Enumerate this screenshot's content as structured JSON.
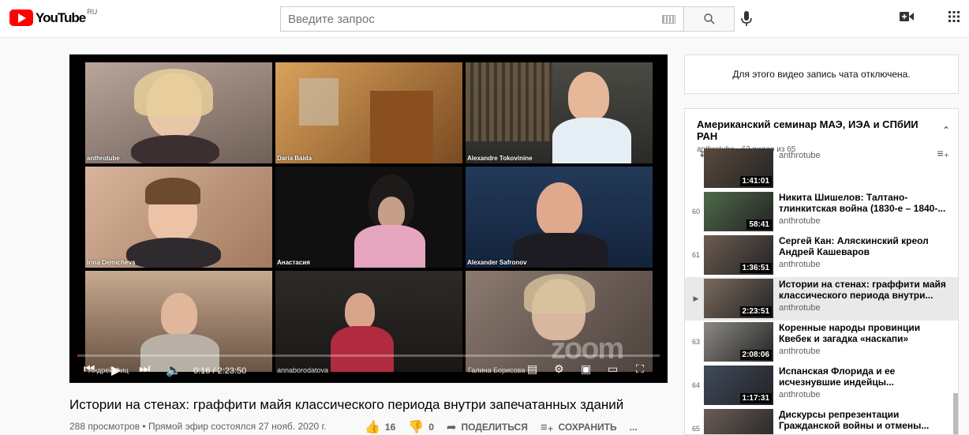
{
  "header": {
    "logo_text": "YouTube",
    "region": "RU",
    "search_placeholder": "Введите запрос"
  },
  "player": {
    "participants": [
      {
        "name": "anthrotube"
      },
      {
        "name": "Daria Baida"
      },
      {
        "name": "Alexandre Tokovinine"
      },
      {
        "name": "Irina Demicheva"
      },
      {
        "name": "Анастасия"
      },
      {
        "name": "Alexander Safronov"
      },
      {
        "name": "Андрей Фиц"
      },
      {
        "name": "annaborodatova"
      },
      {
        "name": "Галина Борисова"
      }
    ],
    "time": "0:16 / 2:23:50",
    "progress": 0.0019,
    "watermark": "zoom"
  },
  "video": {
    "title": "Истории на стенах: граффити майя классического периода внутри запечатанных зданий",
    "meta": "288 просмотров • Прямой эфир состоялся 27 нояб. 2020 г.",
    "likes": "16",
    "dislikes": "0",
    "share_label": "ПОДЕЛИТЬСЯ",
    "save_label": "СОХРАНИТЬ",
    "more_label": "..."
  },
  "chat": {
    "disabled_text": "Для этого видео запись чата отключена."
  },
  "playlist": {
    "title": "Американский семинар МАЭ, ИЭА и СПбИИ РАН",
    "subtitle": "anthrotube - 62 видео из 65",
    "items": [
      {
        "index": "",
        "title": "",
        "channel": "anthrotube",
        "duration": "1:41:01",
        "active": false
      },
      {
        "index": "60",
        "title": "Никита Шишелов: Талтано-тлинкитская война (1830-е – 1840-...",
        "channel": "anthrotube",
        "duration": "58:41",
        "active": false
      },
      {
        "index": "61",
        "title": "Сергей Кан: Аляскинский креол Андрей Кашеваров",
        "channel": "anthrotube",
        "duration": "1:36:51",
        "active": false
      },
      {
        "index": "▶",
        "title": "Истории на стенах: граффити майя классического периода внутри...",
        "channel": "anthrotube",
        "duration": "2:23:51",
        "active": true
      },
      {
        "index": "63",
        "title": "Коренные народы провинции Квебек и загадка «наскапи»",
        "channel": "anthrotube",
        "duration": "2:08:06",
        "active": false
      },
      {
        "index": "64",
        "title": "Испанская Флорида и ее исчезнувшие индейцы...",
        "channel": "anthrotube",
        "duration": "1:17:31",
        "active": false
      },
      {
        "index": "65",
        "title": "Дискурсы репрезентации Гражданской войны и отмены...",
        "channel": "anthrotube",
        "duration": "",
        "active": false
      }
    ]
  },
  "colors": {
    "brand": "#ff0000",
    "text_primary": "#030303",
    "text_secondary": "#606060",
    "active_row": "#e9e9e9"
  }
}
